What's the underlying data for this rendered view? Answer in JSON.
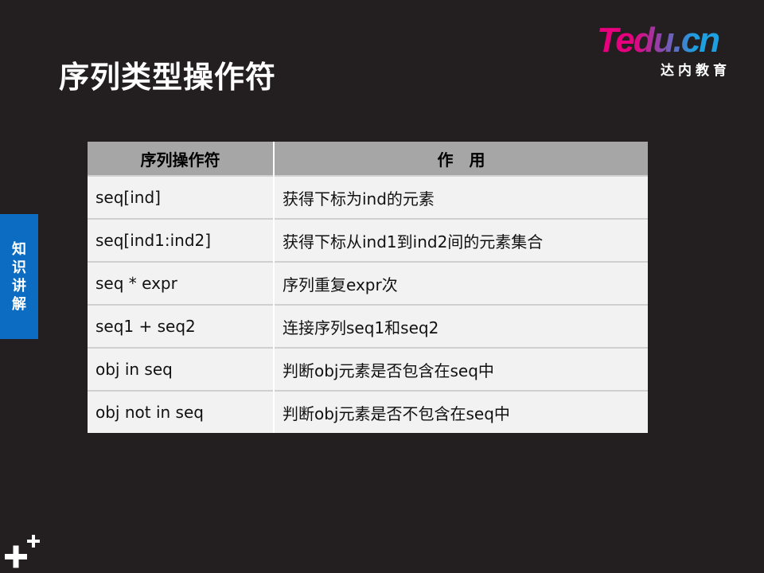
{
  "slide": {
    "title": "序列类型操作符"
  },
  "logo": {
    "wordmark": "Tedu.cn",
    "subtitle": "达内教育",
    "colors": {
      "brand_pink": "#e6007e",
      "brand_blue": "#1d9fe0"
    }
  },
  "side_tab": {
    "label": "知识讲解",
    "color": "#0b6cc1"
  },
  "table": {
    "headers": [
      "序列操作符",
      "作　用"
    ],
    "rows": [
      {
        "op": "seq[ind]",
        "desc": "获得下标为ind的元素"
      },
      {
        "op": "seq[ind1:ind2]",
        "desc": "获得下标从ind1到ind2间的元素集合"
      },
      {
        "op": "seq * expr",
        "desc": "序列重复expr次"
      },
      {
        "op": "seq1 + seq2",
        "desc": "连接序列seq1和seq2"
      },
      {
        "op": "obj in seq",
        "desc": "判断obj元素是否包含在seq中"
      },
      {
        "op": "obj not in seq",
        "desc": "判断obj元素是否不包含在seq中"
      }
    ]
  },
  "colors": {
    "background": "#231f20",
    "header_fill": "#a6a6a6",
    "cell_fill": "#f2f2f2"
  },
  "corner_icon": "plus-icon"
}
